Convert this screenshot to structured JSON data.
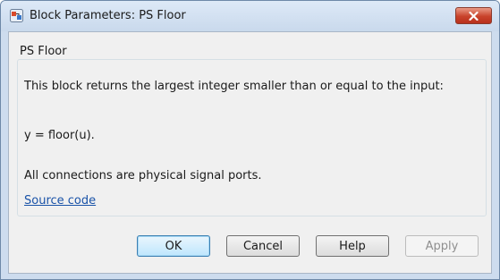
{
  "window": {
    "title": "Block Parameters: PS Floor",
    "icon": "simulink-block-icon",
    "close_icon": "close-icon"
  },
  "group": {
    "label": "PS Floor",
    "description_line1": "This block returns the largest integer smaller than or equal to the input:",
    "formula": "y = floor(u).",
    "connections_note": "All connections are physical signal ports.",
    "source_link": "Source code"
  },
  "buttons": {
    "ok": "OK",
    "cancel": "Cancel",
    "help": "Help",
    "apply": "Apply"
  },
  "colors": {
    "frame": "#cddcee",
    "client": "#f0f0f0",
    "close_button": "#c8432b",
    "link": "#1a53a8"
  }
}
